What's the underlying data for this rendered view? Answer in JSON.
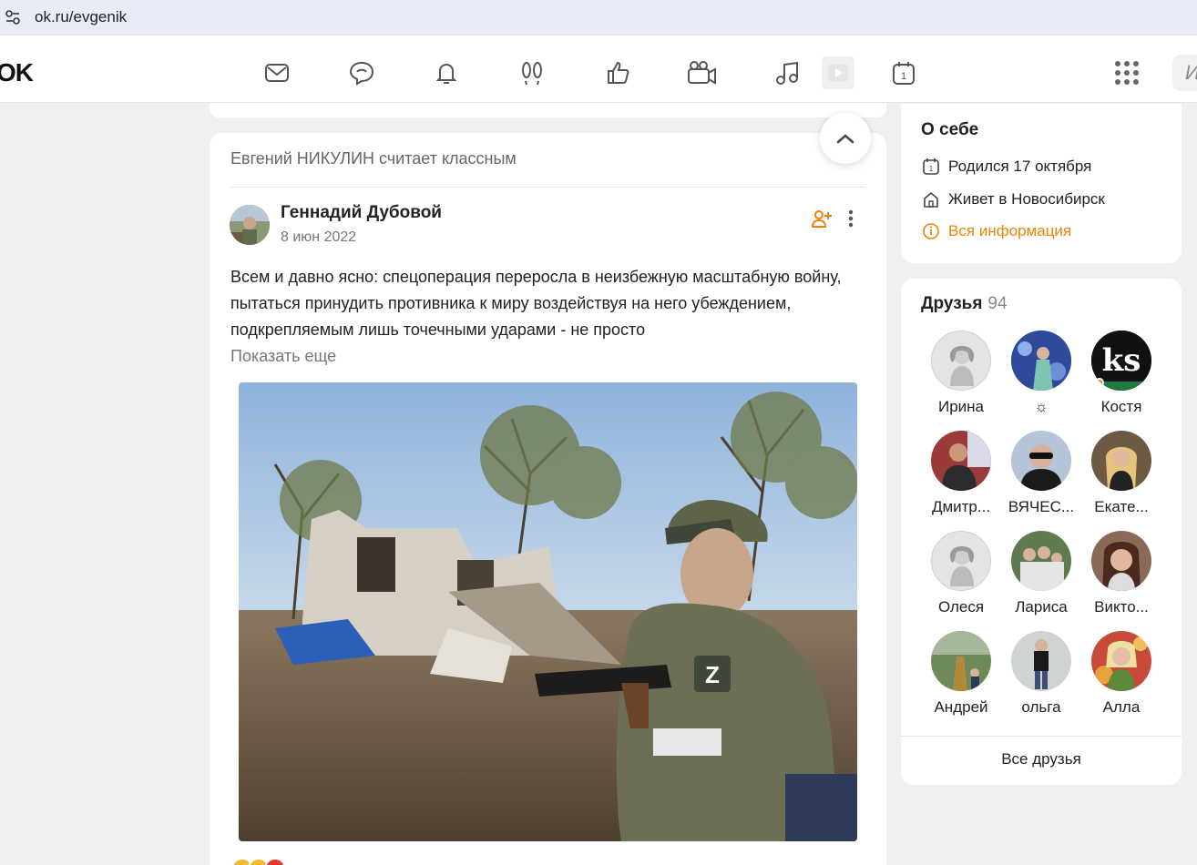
{
  "browser": {
    "url": "ok.ru/evgenik"
  },
  "toolbar": {
    "logo": "OK",
    "icons": [
      "mail-icon",
      "chat-icon",
      "bell-icon",
      "footprints-icon",
      "like-icon",
      "video-camera-icon",
      "music-icon",
      "play-icon",
      "calendar-icon",
      "apps-icon"
    ],
    "search_placeholder": "И"
  },
  "post": {
    "liked_by": "Евгений НИКУЛИН считает классным",
    "author": "Геннадий Дубовой",
    "date": "8 июн 2022",
    "text": "Всем и давно ясно: спецоперация переросла в неизбежную масштабную войну, пытаться принудить противника к миру воздействуя на него убеждением, подкрепляемым лишь точечными ударами - не просто",
    "show_more": "Показать еще"
  },
  "about": {
    "title": "О себе",
    "birthday": "Родился 17 октября",
    "lives": "Живет в Новосибирск",
    "all_info": "Вся информация"
  },
  "friends": {
    "title": "Друзья",
    "count": "94",
    "items": [
      {
        "name": "Ирина"
      },
      {
        "name": "☼"
      },
      {
        "name": "Костя"
      },
      {
        "name": "Дмитр..."
      },
      {
        "name": "ВЯЧЕС..."
      },
      {
        "name": "Екате..."
      },
      {
        "name": "Олеся"
      },
      {
        "name": "Лариса"
      },
      {
        "name": "Викто..."
      },
      {
        "name": "Андрей"
      },
      {
        "name": "ольга"
      },
      {
        "name": "Алла"
      }
    ],
    "all_friends": "Все друзья",
    "kostya_avatar_text": "ks"
  },
  "colors": {
    "accent": "#ee8208",
    "background": "#f0f0f0",
    "card": "#ffffff"
  }
}
